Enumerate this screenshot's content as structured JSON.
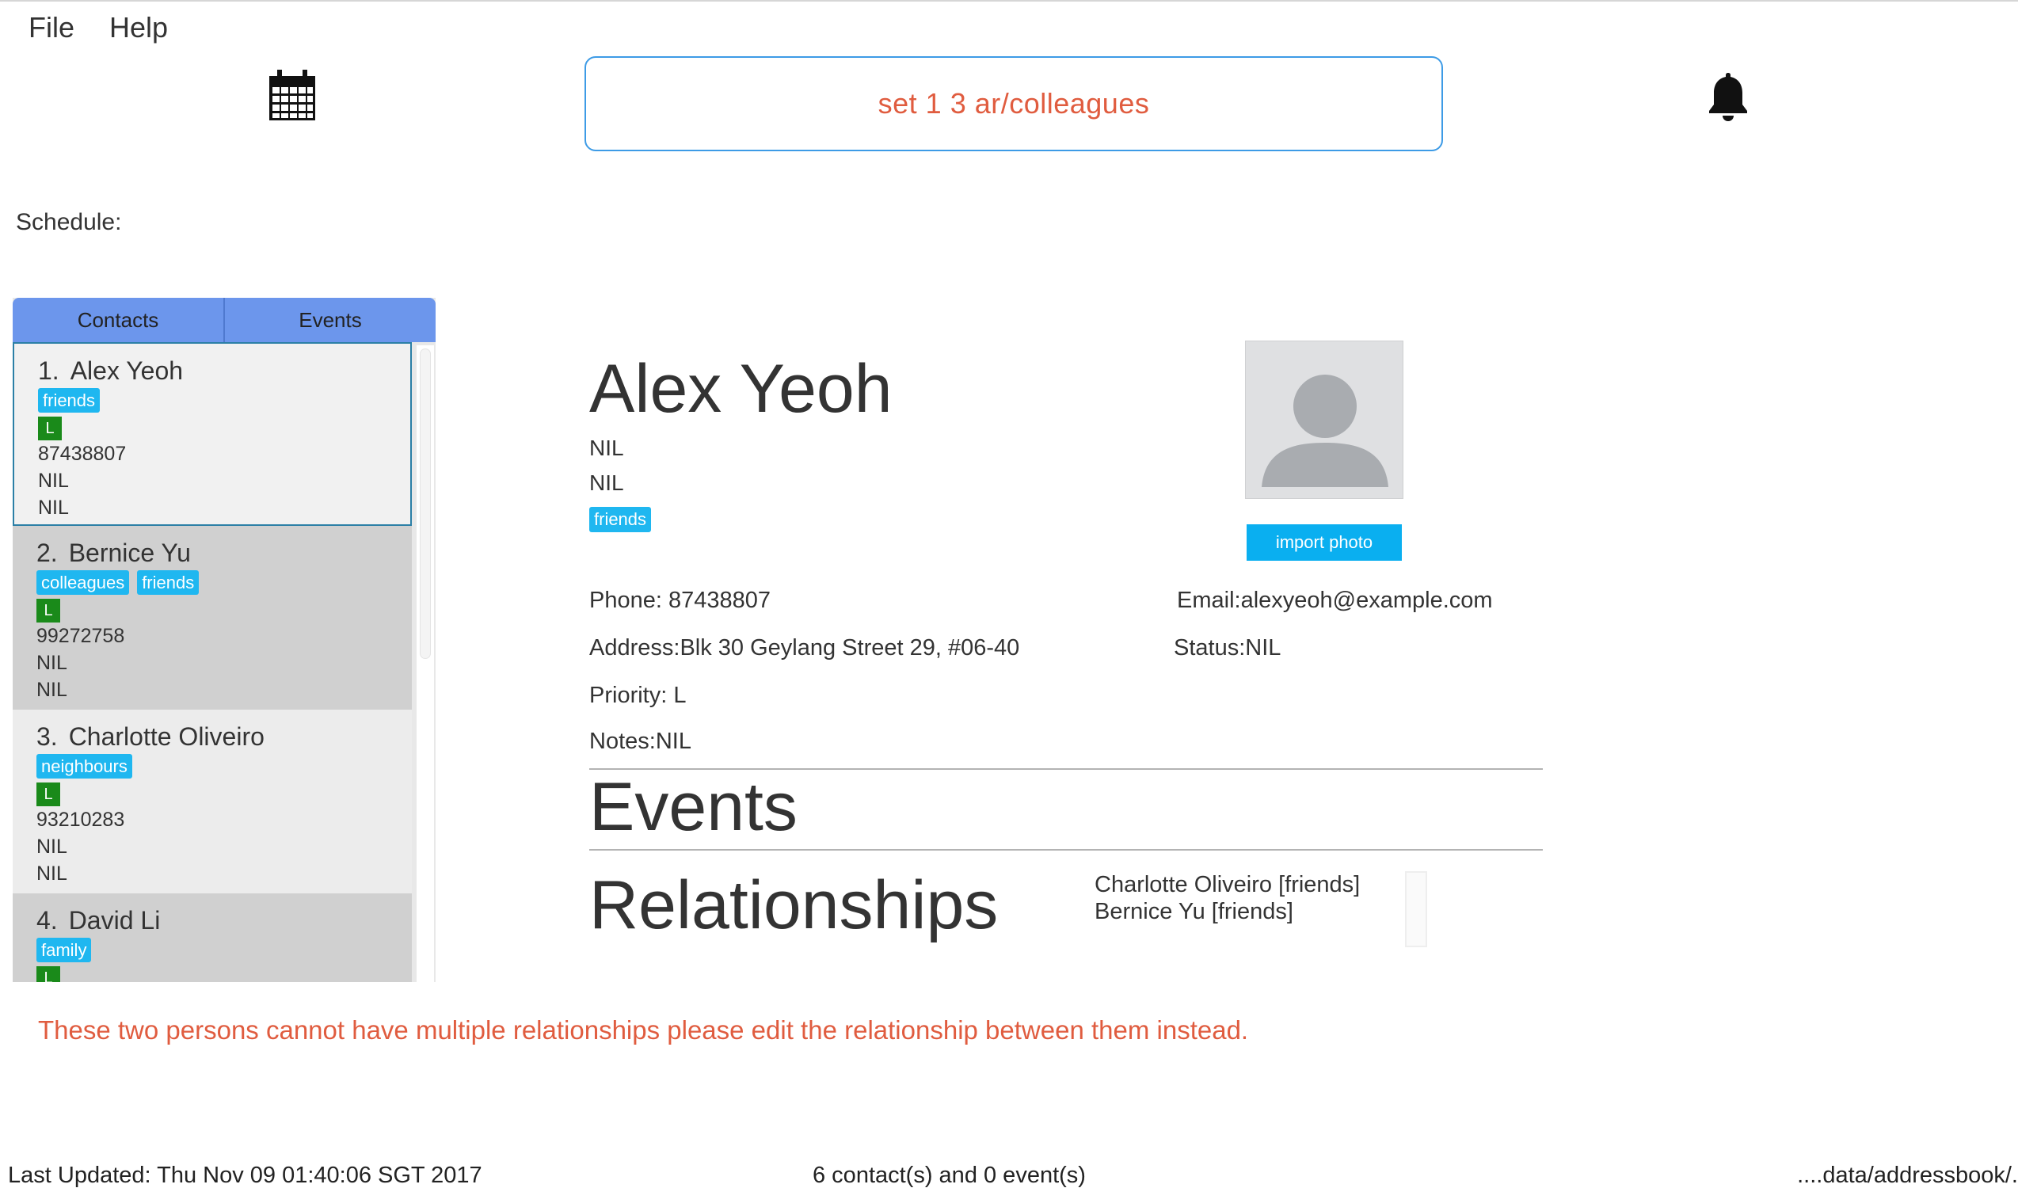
{
  "menu": {
    "file": "File",
    "help": "Help"
  },
  "toolbar": {
    "calendar_icon": "calendar-icon",
    "bell_icon": "bell-icon",
    "command_value": "set 1 3 ar/colleagues"
  },
  "schedule_label": "Schedule:",
  "tabs": {
    "contacts": "Contacts",
    "events": "Events"
  },
  "contacts": [
    {
      "index": "1.",
      "name": "Alex Yeoh",
      "tags": [
        "friends"
      ],
      "priority": "L",
      "phone": "87438807",
      "field2": "NIL",
      "field3": "NIL"
    },
    {
      "index": "2.",
      "name": "Bernice Yu",
      "tags": [
        "colleagues",
        "friends"
      ],
      "priority": "L",
      "phone": "99272758",
      "field2": "NIL",
      "field3": "NIL"
    },
    {
      "index": "3.",
      "name": "Charlotte Oliveiro",
      "tags": [
        "neighbours"
      ],
      "priority": "L",
      "phone": "93210283",
      "field2": "NIL",
      "field3": "NIL"
    },
    {
      "index": "4.",
      "name": "David Li",
      "tags": [
        "family"
      ],
      "priority": "L",
      "phone": "",
      "field2": "",
      "field3": ""
    }
  ],
  "detail": {
    "name": "Alex Yeoh",
    "line1": "NIL",
    "line2": "NIL",
    "tag": "friends",
    "import_photo": "import photo",
    "phone_label": "Phone:",
    "phone": "87438807",
    "email_label": "Email:",
    "email": "alexyeoh@example.com",
    "address_label": "Address:",
    "address": "Blk 30 Geylang Street 29, #06-40",
    "status_label": "Status:",
    "status": "NIL",
    "priority_label": "Priority:",
    "priority": "L",
    "notes_label": "Notes:",
    "notes": "NIL",
    "events_title": "Events",
    "relationships_title": "Relationships",
    "relationships": [
      "Charlotte Oliveiro [friends]",
      "Bernice Yu [friends]"
    ]
  },
  "error_message": "These two persons cannot have multiple relationships please edit the relationship between them instead.",
  "statusbar": {
    "last_updated": "Last Updated: Thu Nov 09 01:40:06 SGT 2017",
    "counts": "6 contact(s) and 0 event(s)",
    "path": "....data/addressbook/."
  },
  "colors": {
    "accent": "#3d9be6",
    "tag": "#1fb7f0",
    "priority": "#1a8a1a",
    "error": "#e05c3f",
    "tabs": "#6c96ec"
  }
}
